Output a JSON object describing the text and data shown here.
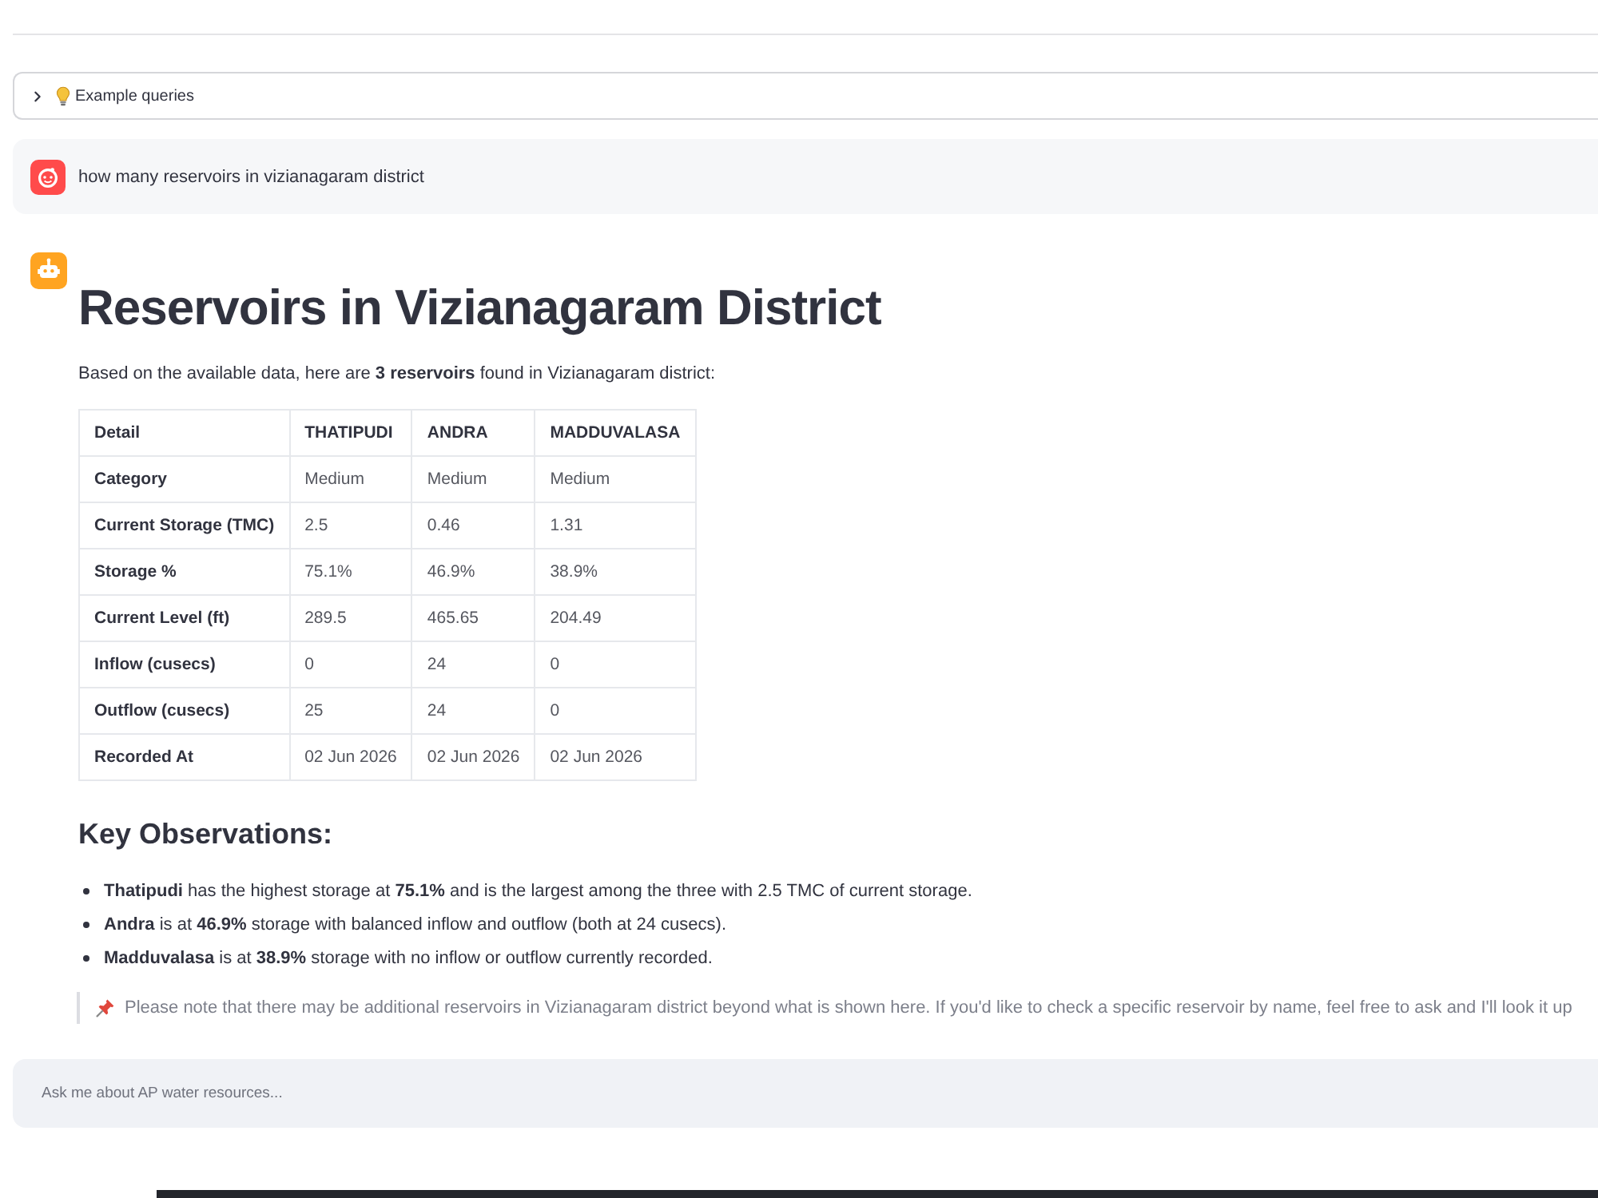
{
  "top_expander": {
    "label": "Example queries",
    "expanded": false
  },
  "user_message": {
    "text": "how many reservoirs in vizianagaram district"
  },
  "assistant_message": {
    "title": "Reservoirs in Vizianagaram District",
    "intro": "Based on the available data, here are **3 reservoirs** found in Vizianagaram district:",
    "table": {
      "columns": [
        "Detail",
        "THATIPUDI",
        "ANDRA",
        "MADDUVALASA"
      ],
      "rows": [
        [
          "Category",
          "Medium",
          "Medium",
          "Medium"
        ],
        [
          "Current Storage (TMC)",
          "2.5",
          "0.46",
          "1.31"
        ],
        [
          "Storage %",
          "75.1%",
          "46.9%",
          "38.9%"
        ],
        [
          "Current Level (ft)",
          "289.5",
          "465.65",
          "204.49"
        ],
        [
          "Inflow (cusecs)",
          "0",
          "24",
          "0"
        ],
        [
          "Outflow (cusecs)",
          "25",
          "24",
          "0"
        ],
        [
          "Recorded At",
          "02 Jun 2026",
          "02 Jun 2026",
          "02 Jun 2026"
        ]
      ]
    },
    "observations_heading": "Key Observations:",
    "observations": [
      "**Thatipudi** has the highest storage at **75.1%** and is the largest among the three with 2.5 TMC of current storage.",
      "**Andra** is at **46.9%** storage with balanced inflow and outflow (both at 24 cusecs).",
      "**Madduvalasa** is at **38.9%** storage with no inflow or outflow currently recorded."
    ],
    "note": "Please note that there may be additional reservoirs in Vizianagaram district beyond what is shown here. If you'd like to check a specific reservoir by name, feel free to ask and I'll look it up"
  },
  "chat_input": {
    "placeholder": "Ask me about AP water resources..."
  }
}
